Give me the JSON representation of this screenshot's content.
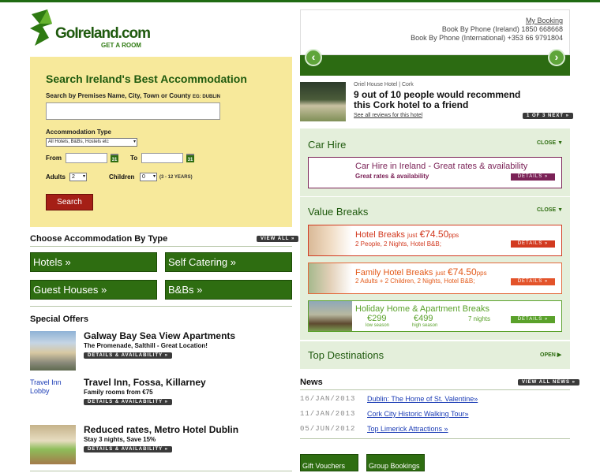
{
  "colors": {
    "brand_green": "#2e6d11",
    "panel_yellow": "#f7e99b",
    "car_purple": "#7b2257",
    "breaks_red": "#d23a20",
    "holiday_green": "#5aa12b"
  },
  "logo": {
    "name": "GoIreland.com",
    "tagline": "GET A ROOM"
  },
  "booking": {
    "my_booking": "My Booking",
    "phone_ireland": "Book By Phone (Ireland) 1850 668668",
    "phone_intl": "Book By Phone (International) +353 66 9791804"
  },
  "slider": {
    "prev_icon": "chevron-left-icon",
    "next_icon": "chevron-right-icon"
  },
  "review": {
    "source": "Oriel House Hotel | Cork",
    "headline": "9 out of 10 people would recommend this Cork hotel to a friend",
    "link": "See all reviews for this hotel",
    "pager": "1 OF 3 NEXT »"
  },
  "search": {
    "title": "Search Ireland's Best Accommodation",
    "premises_label": "Search by Premises Name, City, Town or County",
    "premises_hint": "EG: DUBLIN",
    "premises_value": "",
    "type_label": "Accommodation Type",
    "type_selected": "All Hotels, B&Bs, Hostels etc",
    "from_label": "From",
    "to_label": "To",
    "cal_label": "31",
    "adults_label": "Adults",
    "adults_value": "2",
    "children_label": "Children",
    "children_value": "0",
    "children_hint": "(3 - 12 YEARS)",
    "button": "Search"
  },
  "choose": {
    "title": "Choose Accommodation By Type",
    "view_all": "VIEW ALL »",
    "types": [
      "Hotels »",
      "Self Catering »",
      "Guest Houses »",
      "B&Bs »"
    ]
  },
  "offers": {
    "title": "Special Offers",
    "details": "DETAILS & AVAILABILITY »",
    "items": [
      {
        "title": "Galway Bay Sea View Apartments",
        "sub": "The Promenade, Salthill - Great Location!"
      },
      {
        "title": "Travel Inn, Fossa, Killarney",
        "sub": "Family rooms from €75",
        "img_alt": "Travel Inn Lobby"
      },
      {
        "title": "Reduced rates, Metro Hotel Dublin",
        "sub": "Stay 3 nights, Save 15%"
      }
    ]
  },
  "car_hire": {
    "title": "Car Hire",
    "close": "CLOSE",
    "headline": "Car Hire in Ireland - Great rates & availability",
    "sub": "Great rates & availability",
    "btn": "DETAILS »"
  },
  "value_breaks": {
    "title": "Value Breaks",
    "close": "CLOSE",
    "btn": "DETAILS »",
    "hotel": {
      "title": "Hotel Breaks",
      "just": "just",
      "price": "€74.50",
      "pps": "pps",
      "sub": "2 People, 2 Nights, Hotel B&B;"
    },
    "family": {
      "title": "Family Hotel Breaks",
      "just": "just",
      "price": "€74.50",
      "pps": "pps",
      "sub": "2 Adults + 2 Children, 2 Nights, Hotel B&B;"
    },
    "holiday": {
      "title": "Holiday Home & Apartment Breaks",
      "low_price": "€299",
      "low_label": "low season",
      "high_price": "€499",
      "high_label": "high season",
      "nights": "7 nights"
    }
  },
  "destinations": {
    "title": "Top Destinations",
    "open": "OPEN"
  },
  "news": {
    "title": "News",
    "view_all": "VIEW ALL NEWS »",
    "items": [
      {
        "date": "16/JAN/2013",
        "title": "Dublin: The Home of St. Valentine»"
      },
      {
        "date": "11/JAN/2013",
        "title": "Cork City Historic Walking Tour»"
      },
      {
        "date": "05/JUN/2012",
        "title": "Top Limerick Attractions »"
      }
    ]
  },
  "footer_buttons": {
    "gift": "Gift Vouchers",
    "group": "Group Bookings"
  }
}
